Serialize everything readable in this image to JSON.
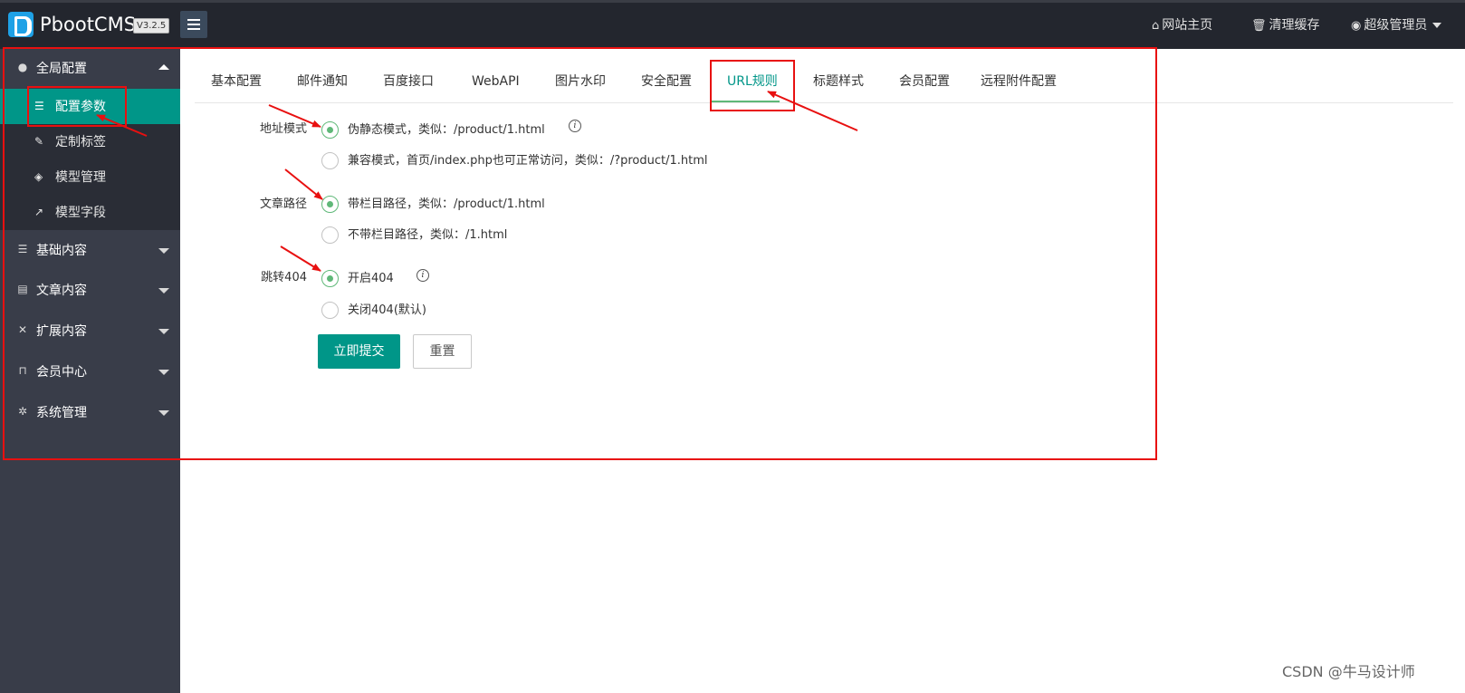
{
  "header": {
    "brand": "PbootCMS",
    "version": "V3.2.5",
    "links": [
      {
        "icon": "home-icon",
        "label": "网站主页"
      },
      {
        "icon": "trash-icon",
        "label": "清理缓存"
      },
      {
        "icon": "user-circle-icon",
        "label": "超级管理员"
      }
    ]
  },
  "sidebar": {
    "groups": [
      {
        "icon": "globe-icon",
        "label": "全局配置",
        "expanded": true,
        "items": [
          {
            "icon": "sliders-icon",
            "label": "配置参数",
            "active": true
          },
          {
            "icon": "wrench-icon",
            "label": "定制标签"
          },
          {
            "icon": "cube-icon",
            "label": "模型管理"
          },
          {
            "icon": "external-link-icon",
            "label": "模型字段"
          }
        ]
      },
      {
        "icon": "sliders-icon",
        "label": "基础内容"
      },
      {
        "icon": "file-icon",
        "label": "文章内容"
      },
      {
        "icon": "expand-icon",
        "label": "扩展内容"
      },
      {
        "icon": "lock-icon",
        "label": "会员中心"
      },
      {
        "icon": "gear-icon",
        "label": "系统管理"
      }
    ]
  },
  "tabs": [
    "基本配置",
    "邮件通知",
    "百度接口",
    "WebAPI",
    "图片水印",
    "安全配置",
    "URL规则",
    "标题样式",
    "会员配置",
    "远程附件配置"
  ],
  "active_tab": "URL规则",
  "form": {
    "url_mode": {
      "label": "地址模式",
      "options": [
        "伪静态模式，类似：/product/1.html",
        "兼容模式，首页/index.php也可正常访问，类似：/?product/1.html"
      ],
      "selected": 0
    },
    "article_path": {
      "label": "文章路径",
      "options": [
        "带栏目路径，类似：/product/1.html",
        "不带栏目路径，类似：/1.html"
      ],
      "selected": 0
    },
    "jump_404": {
      "label": "跳转404",
      "options": [
        "开启404",
        "关闭404(默认)"
      ],
      "selected": 0
    },
    "submit_label": "立即提交",
    "reset_label": "重置"
  },
  "watermark": "CSDN @牛马设计师",
  "colors": {
    "accent": "#009688",
    "radio": "#5fb878",
    "header": "#23262e",
    "sidebar": "#393d49",
    "annotation": "#e81010"
  }
}
